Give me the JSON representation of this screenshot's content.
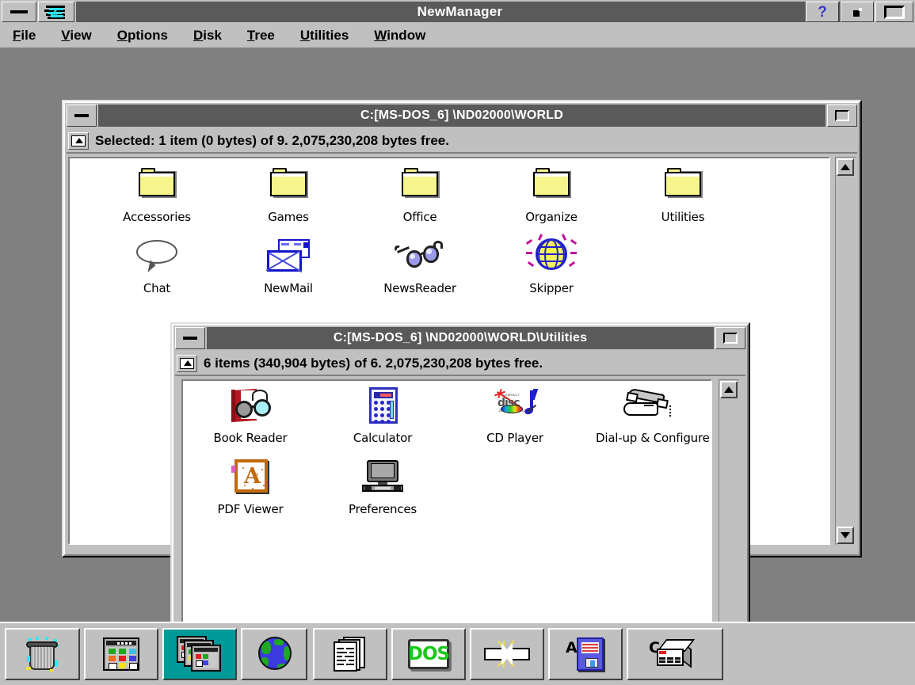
{
  "window": {
    "title": "NewManager",
    "controls": {
      "minimize_label": "minimize",
      "logo_label": "system-menu",
      "help_label": "?",
      "restore_label": "restore",
      "maximize_label": "maximize"
    }
  },
  "menu": {
    "items": [
      {
        "label": "File",
        "accel": "F"
      },
      {
        "label": "View",
        "accel": "V"
      },
      {
        "label": "Options",
        "accel": "O"
      },
      {
        "label": "Disk",
        "accel": "D"
      },
      {
        "label": "Tree",
        "accel": "T"
      },
      {
        "label": "Utilities",
        "accel": "U"
      },
      {
        "label": "Window",
        "accel": "W"
      }
    ]
  },
  "windows": [
    {
      "id": "world",
      "title": "C:[MS-DOS_6] \\ND02000\\WORLD",
      "status": "Selected: 1 item (0 bytes) of 9.  2,075,230,208 bytes free.",
      "items": [
        {
          "label": "Accessories",
          "icon": "folder-icon"
        },
        {
          "label": "Games",
          "icon": "folder-icon"
        },
        {
          "label": "Office",
          "icon": "folder-icon"
        },
        {
          "label": "Organize",
          "icon": "folder-icon"
        },
        {
          "label": "Utilities",
          "icon": "folder-icon"
        },
        {
          "label": "Chat",
          "icon": "speech-bubble-icon"
        },
        {
          "label": "NewMail",
          "icon": "envelope-icon"
        },
        {
          "label": "NewsReader",
          "icon": "eyeglasses-icon"
        },
        {
          "label": "Skipper",
          "icon": "globe-icon"
        }
      ]
    },
    {
      "id": "utilities",
      "title": "C:[MS-DOS_6] \\ND02000\\WORLD\\Utilities",
      "status": "6 items (340,904 bytes) of 6.  2,075,230,208 bytes free.",
      "items": [
        {
          "label": "Book Reader",
          "icon": "book-glasses-icon"
        },
        {
          "label": "Calculator",
          "icon": "calculator-icon"
        },
        {
          "label": "CD Player",
          "icon": "compact-disc-icon"
        },
        {
          "label": "Dial-up & Configure",
          "icon": "telephone-hand-icon"
        },
        {
          "label": "PDF Viewer",
          "icon": "acrobat-icon"
        },
        {
          "label": "Preferences",
          "icon": "computer-icon"
        }
      ]
    }
  ],
  "taskbar": {
    "items": [
      {
        "name": "recycle-bin",
        "icon": "trash-can-icon",
        "letter": "",
        "active": false
      },
      {
        "name": "program-manager",
        "icon": "program-group-icon",
        "letter": "",
        "active": false
      },
      {
        "name": "new-manager",
        "icon": "program-group-stack-icon",
        "letter": "",
        "active": true
      },
      {
        "name": "internet",
        "icon": "globe-earth-icon",
        "letter": "",
        "active": false
      },
      {
        "name": "documents",
        "icon": "documents-stack-icon",
        "letter": "",
        "active": false
      },
      {
        "name": "ms-dos-prompt",
        "icon": "dos-icon",
        "letter": "",
        "active": false
      },
      {
        "name": "close-all",
        "icon": "collide-arrows-icon",
        "letter": "",
        "active": false
      },
      {
        "name": "drive-a",
        "icon": "floppy-disk-icon",
        "letter": "A",
        "active": false
      },
      {
        "name": "drive-c",
        "icon": "hard-disk-icon",
        "letter": "C",
        "active": false
      }
    ]
  },
  "colors": {
    "desktop": "#808080",
    "face": "#c0c0c0",
    "titlebar_active": "#5a5a5a",
    "selection": "#000080",
    "taskbar_active": "#009999",
    "folder": "#f5f58c"
  }
}
